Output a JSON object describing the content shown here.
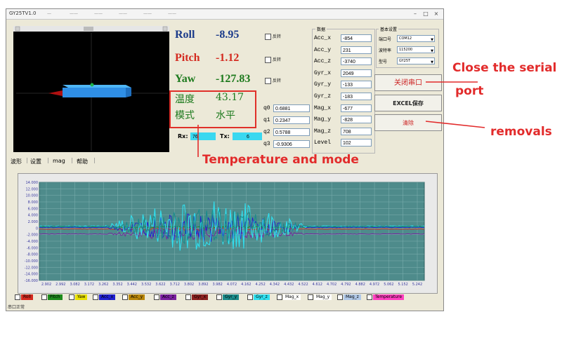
{
  "window": {
    "title": "GY25TV1.0",
    "menus": [
      "—",
      "——",
      "——",
      "——",
      "——",
      "——"
    ]
  },
  "euler": [
    {
      "label": "Roll",
      "value": "-8.95",
      "color": "#1a3a8a",
      "check": "反转"
    },
    {
      "label": "Pitch",
      "value": "-1.12",
      "color": "#d42a1f",
      "check": "反转"
    },
    {
      "label": "Yaw",
      "value": "-127.83",
      "color": "#1d7a1d",
      "check": "反转"
    }
  ],
  "temp": {
    "label": "温度",
    "value": "43.17"
  },
  "mode": {
    "label": "模式",
    "value": "水平"
  },
  "rx": {
    "label": "Rx:",
    "value": "76"
  },
  "tx": {
    "label": "Tx:",
    "value": "6"
  },
  "quat": [
    {
      "label": "q0",
      "value": "0.6881"
    },
    {
      "label": "q1",
      "value": "0.2347"
    },
    {
      "label": "q2",
      "value": "0.5788"
    },
    {
      "label": "q3",
      "value": "-0.9306"
    }
  ],
  "sensors": {
    "group": "数据",
    "items": [
      {
        "label": "Acc_x",
        "value": "-854"
      },
      {
        "label": "Acc_y",
        "value": "231"
      },
      {
        "label": "Acc_z",
        "value": "-3740"
      },
      {
        "label": "Gyr_x",
        "value": "2049"
      },
      {
        "label": "Gyr_y",
        "value": "-133"
      },
      {
        "label": "Gyr_z",
        "value": "-183"
      },
      {
        "label": "Mag_x",
        "value": "-677"
      },
      {
        "label": "Mag_y",
        "value": "-828"
      },
      {
        "label": "Mag_z",
        "value": "708"
      },
      {
        "label": "Level",
        "value": "102"
      }
    ]
  },
  "settings": {
    "group": "基本设置",
    "rows": [
      {
        "label": "端口号",
        "value": "COM12"
      },
      {
        "label": "波特率",
        "value": "115200"
      },
      {
        "label": "型号",
        "value": "GY25T"
      }
    ]
  },
  "buttons": {
    "close_serial": "关闭串口",
    "excel": "EXCEL保存",
    "clear": "清除"
  },
  "tabs": [
    "波形",
    "设置",
    "mag",
    "帮助"
  ],
  "status": "串口正常",
  "annotations": {
    "close": [
      "Close the serial",
      "port"
    ],
    "removals": "removals",
    "temp_mode": "Temperature and mode"
  },
  "colors": {
    "annotation": "#e22b2b",
    "chart_bg": "#4e8b8b"
  },
  "chart_data": {
    "type": "line",
    "y_ticks": [
      "14.000",
      "12.000",
      "10.000",
      "8.000",
      "6.000",
      "4.000",
      "2.000",
      "0",
      "-2.000",
      "-4.000",
      "-6.000",
      "-8.000",
      "-10.000",
      "-12.000",
      "-14.000",
      "-16.000"
    ],
    "x_ticks": [
      "2.902",
      "2.992",
      "3.082",
      "3.172",
      "3.262",
      "3.352",
      "3.442",
      "3.532",
      "3.622",
      "3.712",
      "3.802",
      "3.892",
      "3.982",
      "4.072",
      "4.162",
      "4.252",
      "4.342",
      "4.432",
      "4.522",
      "4.612",
      "4.702",
      "4.792",
      "4.882",
      "4.972",
      "5.062",
      "5.152",
      "5.242"
    ],
    "ylim": [
      -16,
      14
    ],
    "series": [
      {
        "name": "Roll",
        "color": "#d42a1f"
      },
      {
        "name": "Pitch",
        "color": "#1d8a1d"
      },
      {
        "name": "Yaw",
        "color": "#e8e000"
      },
      {
        "name": "Acc_x",
        "color": "#2020d0"
      },
      {
        "name": "Acc_y",
        "color": "#b8860b"
      },
      {
        "name": "Acc_z",
        "color": "#7a1fa0"
      },
      {
        "name": "Gyr_x",
        "color": "#8b2020"
      },
      {
        "name": "Gyr_y",
        "color": "#1b8b8b"
      },
      {
        "name": "Gyr_z",
        "color": "#30e0f0"
      },
      {
        "name": "Mag_x",
        "color": "#ffffff"
      },
      {
        "name": "Mag_y",
        "color": "#ffffff"
      },
      {
        "name": "Mag_z",
        "color": "#b0c8e8"
      },
      {
        "name": "Temperature",
        "color": "#ff40c0"
      }
    ]
  }
}
